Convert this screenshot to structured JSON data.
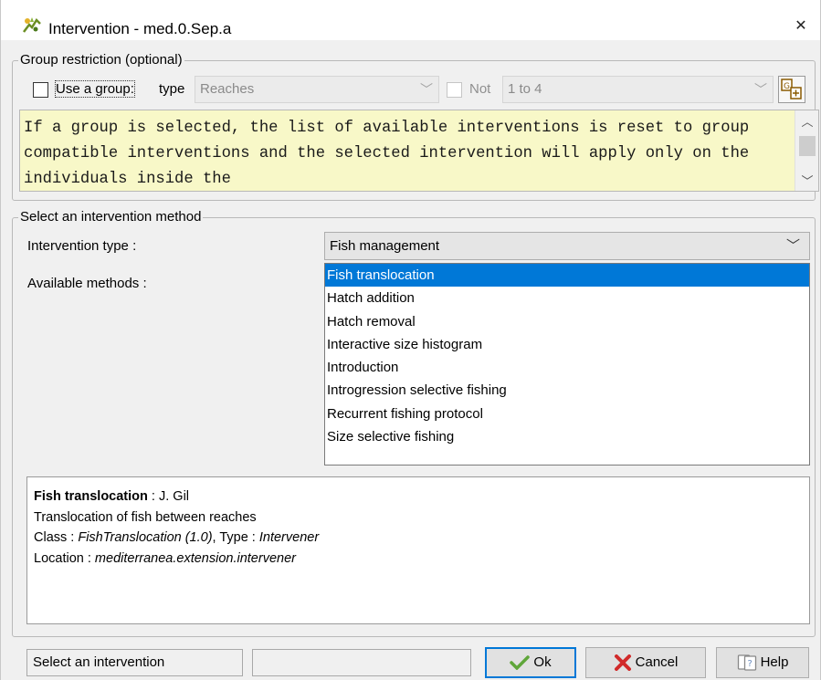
{
  "window": {
    "title": "Intervention - med.0.Sep.a",
    "close_symbol": "✕"
  },
  "group_restriction": {
    "legend": "Group restriction (optional)",
    "use_group_label": "Use a group:",
    "use_group_checked": false,
    "type_label": "type",
    "type_value": "Reaches",
    "not_label": "Not",
    "not_checked": false,
    "range_value": "1 to 4",
    "info_text": "If a group is selected, the list of available interventions is reset to group compatible interventions and the selected intervention will apply only on the individuals inside the"
  },
  "method": {
    "legend": "Select an intervention method",
    "type_label": "Intervention type :",
    "type_value": "Fish management",
    "methods_label": "Available methods :",
    "methods": [
      "Fish translocation",
      "Hatch addition",
      "Hatch removal",
      "Interactive size histogram",
      "Introduction",
      "Introgression selective fishing",
      "Recurrent fishing protocol",
      "Size selective fishing"
    ],
    "selected_index": 0
  },
  "description": {
    "name": "Fish translocation",
    "author_sep": " : ",
    "author": "J. Gil",
    "summary": "Translocation of fish between reaches",
    "class_label": "Class : ",
    "class_value": "FishTranslocation (1.0)",
    "type_label": ", Type : ",
    "type_value": "Intervener",
    "location_label": "Location : ",
    "location_value": "mediterranea.extension.intervener"
  },
  "footer": {
    "status_text": "Select an intervention",
    "status_text2": "",
    "ok_label": "Ok",
    "cancel_label": "Cancel",
    "help_label": "Help"
  },
  "colors": {
    "selection": "#0078d7",
    "info_background": "#f8f8c8",
    "ok_check": "#5fa63a",
    "cancel_x": "#d12a2a"
  }
}
